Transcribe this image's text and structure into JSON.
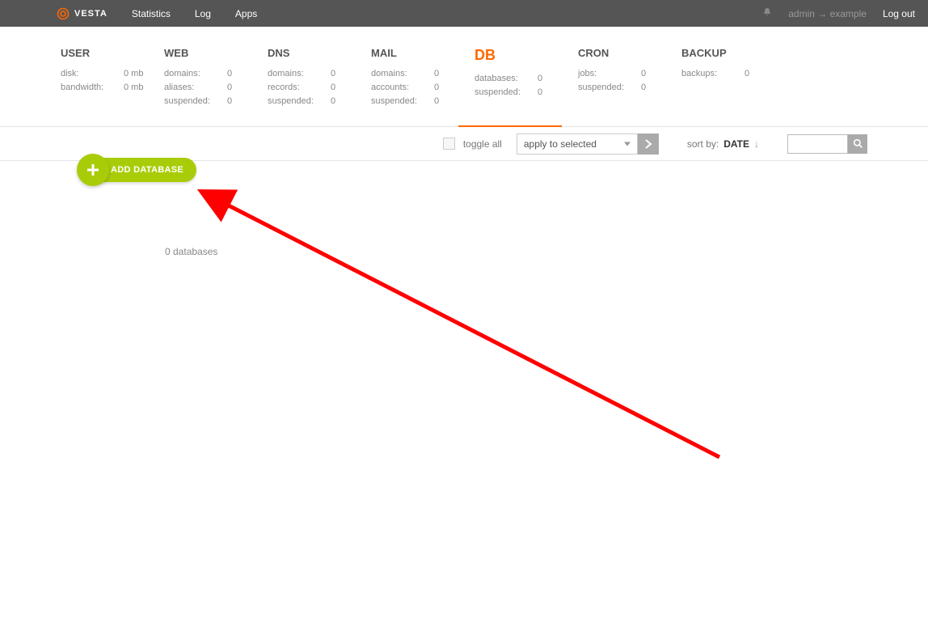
{
  "topbar": {
    "brand": "VESTA",
    "links": {
      "statistics": "Statistics",
      "log": "Log",
      "apps": "Apps"
    },
    "user_path": "admin → example",
    "logout": "Log out"
  },
  "tabs": [
    {
      "id": "user",
      "title": "USER",
      "active": false,
      "stats": [
        {
          "k": "disk:",
          "v": "0 mb"
        },
        {
          "k": "bandwidth:",
          "v": "0 mb"
        }
      ]
    },
    {
      "id": "web",
      "title": "WEB",
      "active": false,
      "stats": [
        {
          "k": "domains:",
          "v": "0"
        },
        {
          "k": "aliases:",
          "v": "0"
        },
        {
          "k": "suspended:",
          "v": "0"
        }
      ]
    },
    {
      "id": "dns",
      "title": "DNS",
      "active": false,
      "stats": [
        {
          "k": "domains:",
          "v": "0"
        },
        {
          "k": "records:",
          "v": "0"
        },
        {
          "k": "suspended:",
          "v": "0"
        }
      ]
    },
    {
      "id": "mail",
      "title": "MAIL",
      "active": false,
      "stats": [
        {
          "k": "domains:",
          "v": "0"
        },
        {
          "k": "accounts:",
          "v": "0"
        },
        {
          "k": "suspended:",
          "v": "0"
        }
      ]
    },
    {
      "id": "db",
      "title": "DB",
      "active": true,
      "stats": [
        {
          "k": "databases:",
          "v": "0"
        },
        {
          "k": "suspended:",
          "v": "0"
        }
      ]
    },
    {
      "id": "cron",
      "title": "CRON",
      "active": false,
      "stats": [
        {
          "k": "jobs:",
          "v": "0"
        },
        {
          "k": "suspended:",
          "v": "0"
        }
      ]
    },
    {
      "id": "backup",
      "title": "BACKUP",
      "active": false,
      "stats": [
        {
          "k": "backups:",
          "v": "0"
        }
      ]
    }
  ],
  "toolbar": {
    "toggle_all": "toggle all",
    "apply_label": "apply to selected",
    "sort_by_label": "sort by:",
    "sort_field": "DATE",
    "sort_dir_glyph": "↓",
    "search_placeholder": ""
  },
  "add_button": {
    "label": "ADD DATABASE"
  },
  "content": {
    "count_text": "0 databases"
  }
}
